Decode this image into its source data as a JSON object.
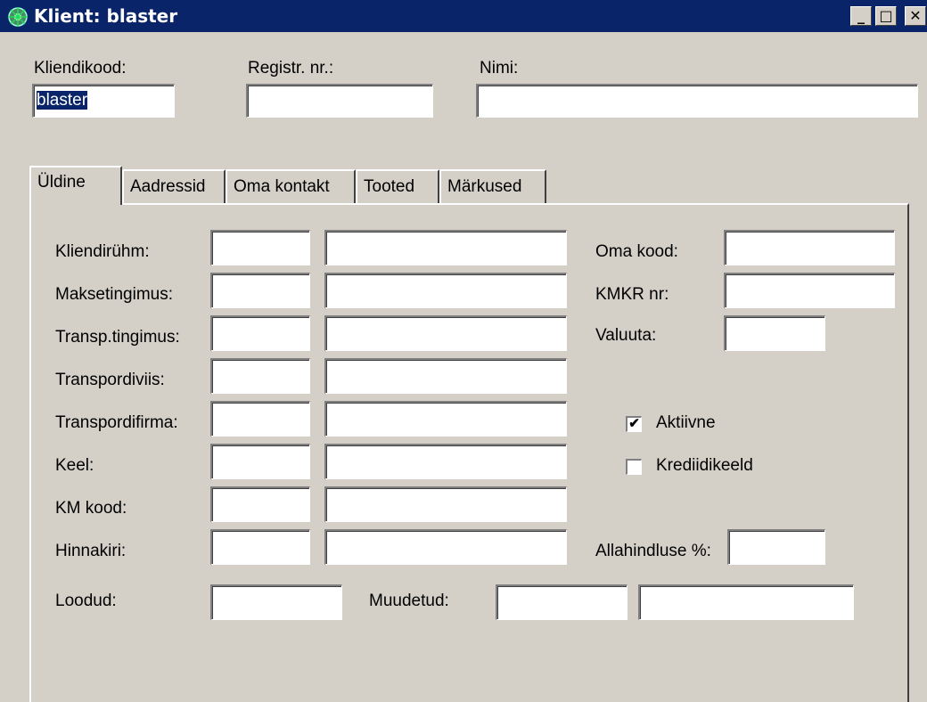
{
  "window": {
    "title": "Klient: blaster",
    "minimize_glyph": "_",
    "maximize_glyph": "□",
    "close_glyph": "✕"
  },
  "header": {
    "kliendikood_label": "Kliendikood:",
    "kliendikood_value": "blaster",
    "registr_label": "Registr. nr.:",
    "registr_value": "",
    "nimi_label": "Nimi:",
    "nimi_value": ""
  },
  "tabs": [
    "Üldine",
    "Aadressid",
    "Oma kontakt",
    "Tooted",
    "Märkused"
  ],
  "active_tab": "Üldine",
  "general": {
    "rows": [
      {
        "label": "Kliendirühm:"
      },
      {
        "label": "Maksetingimus:"
      },
      {
        "label": "Transp.tingimus:"
      },
      {
        "label": "Transpordiviis:"
      },
      {
        "label": "Transpordifirma:"
      },
      {
        "label": "Keel:"
      },
      {
        "label": "KM kood:"
      },
      {
        "label": "Hinnakiri:"
      }
    ],
    "oma_kood_label": "Oma kood:",
    "kmkr_label": "KMKR nr:",
    "valuuta_label": "Valuuta:",
    "aktiivne_label": "Aktiivne",
    "aktiivne_checked": true,
    "krediidikeeld_label": "Krediidikeeld",
    "krediidikeeld_checked": false,
    "allahindlus_label": "Allahindluse %:",
    "loodud_label": "Loodud:",
    "muudetud_label": "Muudetud:"
  },
  "colors": {
    "titlebar": "#0a246a",
    "window_bg": "#d4d0c8",
    "field_bg": "#ffffff"
  }
}
